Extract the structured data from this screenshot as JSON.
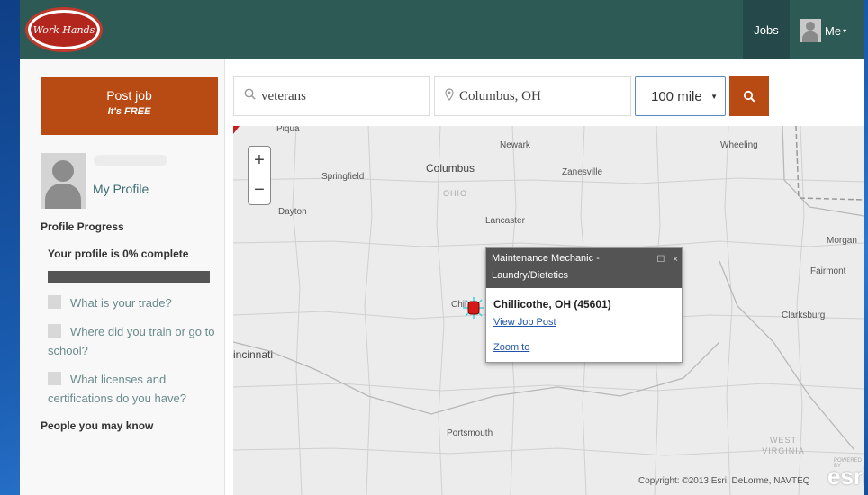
{
  "navbar": {
    "logo_text": "Work Hands",
    "jobs_label": "Jobs",
    "me_label": "Me",
    "caret": "▾"
  },
  "sidebar": {
    "post_job_title": "Post job",
    "post_job_subtitle": "It's FREE",
    "my_profile": "My Profile",
    "profile_progress_title": "Profile Progress",
    "progress_text": "Your profile is 0% complete",
    "progress_percent": 0,
    "checklist": [
      "What is your trade?",
      "Where did you train or go to school?",
      "What licenses and certifications do you have?"
    ],
    "people_title": "People you may know"
  },
  "search": {
    "keyword_value": "veterans",
    "location_value": "Columbus, OH",
    "distance_value": "100 mile",
    "search_icon": "search-icon"
  },
  "map": {
    "places": {
      "piqua": "Piqua",
      "newark": "Newark",
      "wheeling": "Wheeling",
      "springfield": "Springfield",
      "columbus": "Columbus",
      "zanesville": "Zanesville",
      "ohio": "OHIO",
      "dayton": "Dayton",
      "lancaster": "Lancaster",
      "morgantown": "Morgan",
      "fairmont": "Fairmont",
      "clarksburg": "Clarksburg",
      "cincinnati": "incinnati",
      "chillicothe": "Chil",
      "portsmouth": "Portsmouth",
      "west_virginia": "WEST VIRGINIA",
      "partial_g": "g"
    },
    "zoom_in": "+",
    "zoom_out": "−",
    "popup": {
      "job_title": "Maintenance Mechanic - Laundry/Dietetics",
      "location": "Chillicothe, OH (45601)",
      "view_link": "View Job Post",
      "zoom_link": "Zoom to"
    },
    "copyright": "Copyright: ©2013 Esri, DeLorme, NAVTEQ",
    "esri_logo": "esri",
    "esri_powered": "POWERED BY"
  },
  "colors": {
    "navbar": "#2e5a56",
    "accent": "#b84a14",
    "link": "#3d6e72"
  }
}
